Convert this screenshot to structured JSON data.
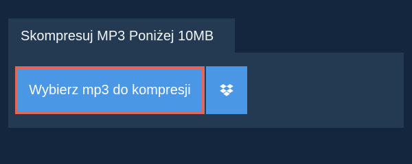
{
  "tab": {
    "label": "Skompresuj MP3 Poniżej 10MB"
  },
  "upload": {
    "label": "Wybierz mp3 do kompresji"
  },
  "dropbox": {
    "icon": "dropbox-icon"
  },
  "colors": {
    "background": "#14263d",
    "panel": "#233a52",
    "button": "#4a97e6",
    "focus_border": "#e2665a",
    "text": "#ffffff"
  }
}
